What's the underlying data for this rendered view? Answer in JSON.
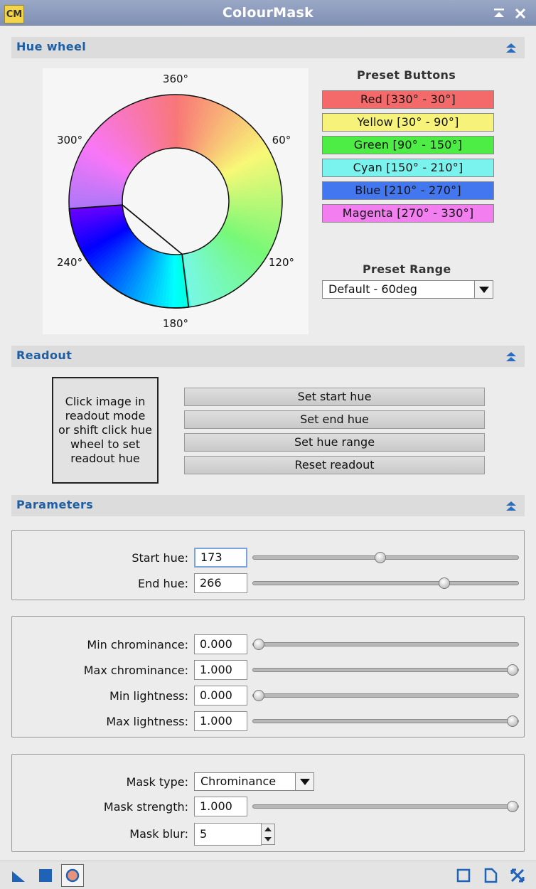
{
  "window": {
    "title": "ColourMask",
    "icon_text": "CM"
  },
  "sections": {
    "hue_wheel": "Hue wheel",
    "readout": "Readout",
    "parameters": "Parameters"
  },
  "hue_wheel": {
    "labels": [
      "360°",
      "60°",
      "120°",
      "180°",
      "240°",
      "300°"
    ],
    "selected_range": [
      173,
      266
    ]
  },
  "presets": {
    "title": "Preset Buttons",
    "buttons": [
      {
        "label": "Red [330° - 30°]",
        "color": "#f46a6a"
      },
      {
        "label": "Yellow [30° - 90°]",
        "color": "#f6f27a"
      },
      {
        "label": "Green [90° - 150°]",
        "color": "#4ded46"
      },
      {
        "label": "Cyan [150° - 210°]",
        "color": "#7af3ef"
      },
      {
        "label": "Blue [210° - 270°]",
        "color": "#4377f0"
      },
      {
        "label": "Magenta [270° - 330°]",
        "color": "#f37ef0"
      }
    ],
    "range_title": "Preset Range",
    "range_value": "Default - 60deg"
  },
  "readout": {
    "info_text": "Click image in readout mode or shift click hue wheel to set readout hue",
    "buttons": [
      "Set start hue",
      "Set end hue",
      "Set hue range",
      "Reset readout"
    ]
  },
  "parameters": {
    "start_hue": {
      "label": "Start hue:",
      "value": "173",
      "fraction": 0.48
    },
    "end_hue": {
      "label": "End hue:",
      "value": "266",
      "fraction": 0.73
    },
    "min_chrominance": {
      "label": "Min chrominance:",
      "value": "0.000",
      "fraction": 0.0
    },
    "max_chrominance": {
      "label": "Max chrominance:",
      "value": "1.000",
      "fraction": 1.0
    },
    "min_lightness": {
      "label": "Min lightness:",
      "value": "0.000",
      "fraction": 0.0
    },
    "max_lightness": {
      "label": "Max lightness:",
      "value": "1.000",
      "fraction": 1.0
    },
    "mask_type": {
      "label": "Mask type:",
      "value": "Chrominance"
    },
    "mask_strength": {
      "label": "Mask strength:",
      "value": "1.000",
      "fraction": 1.0
    },
    "mask_blur": {
      "label": "Mask blur:",
      "value": "5"
    }
  },
  "colors": {
    "accent": "#1d5ea5",
    "titlebar": "#8a99bb"
  }
}
